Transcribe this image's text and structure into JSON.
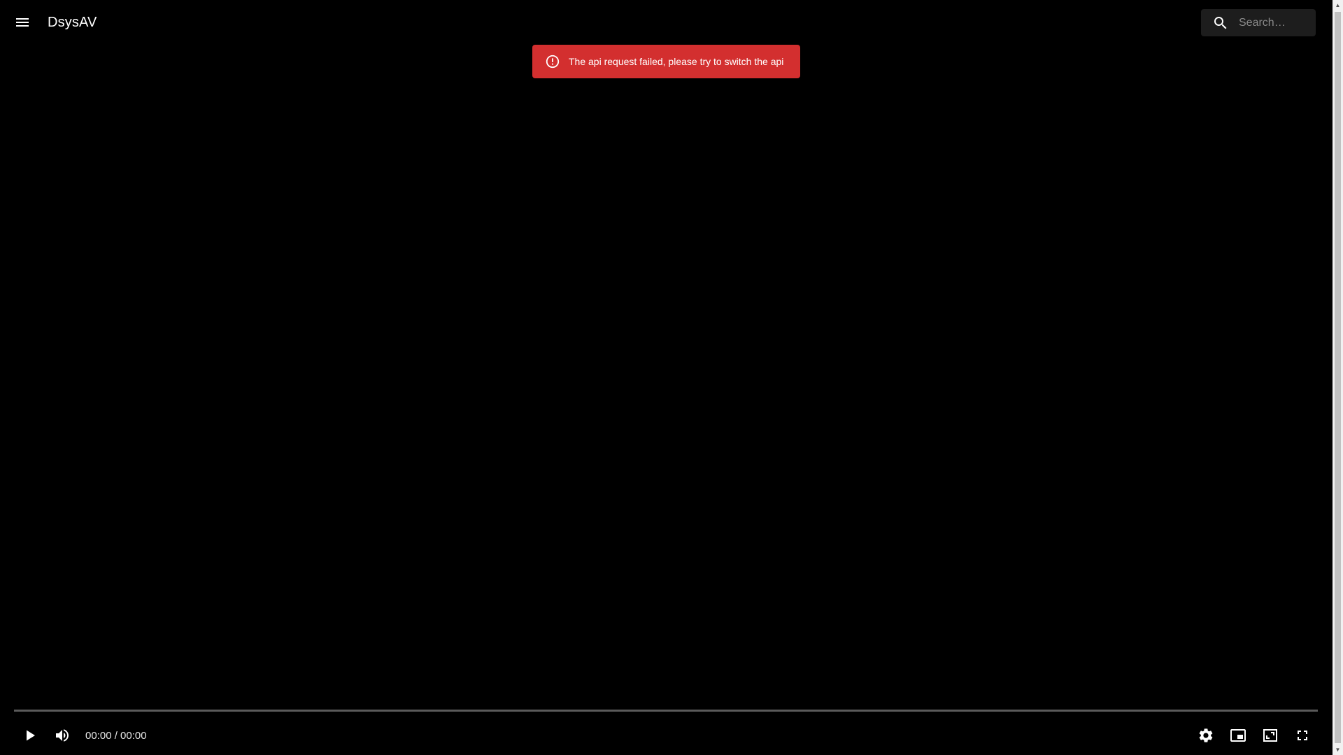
{
  "appbar": {
    "title": "DsysAV",
    "menu_icon": "menu-icon",
    "search": {
      "placeholder": "Search…",
      "value": "",
      "icon": "search-icon"
    }
  },
  "alert": {
    "icon": "error-outline-icon",
    "message": "The api request failed, please try to switch the api",
    "color": "#d32f2f"
  },
  "player": {
    "current_time": "00:00",
    "separator": "/",
    "duration": "00:00",
    "time_display": "00:00 / 00:00",
    "progress": 0,
    "controls": {
      "play": "play-icon",
      "volume": "volume-icon",
      "settings": "settings-icon",
      "pip": "picture-in-picture-icon",
      "web_fullscreen": "web-fullscreen-icon",
      "fullscreen": "fullscreen-icon"
    }
  }
}
